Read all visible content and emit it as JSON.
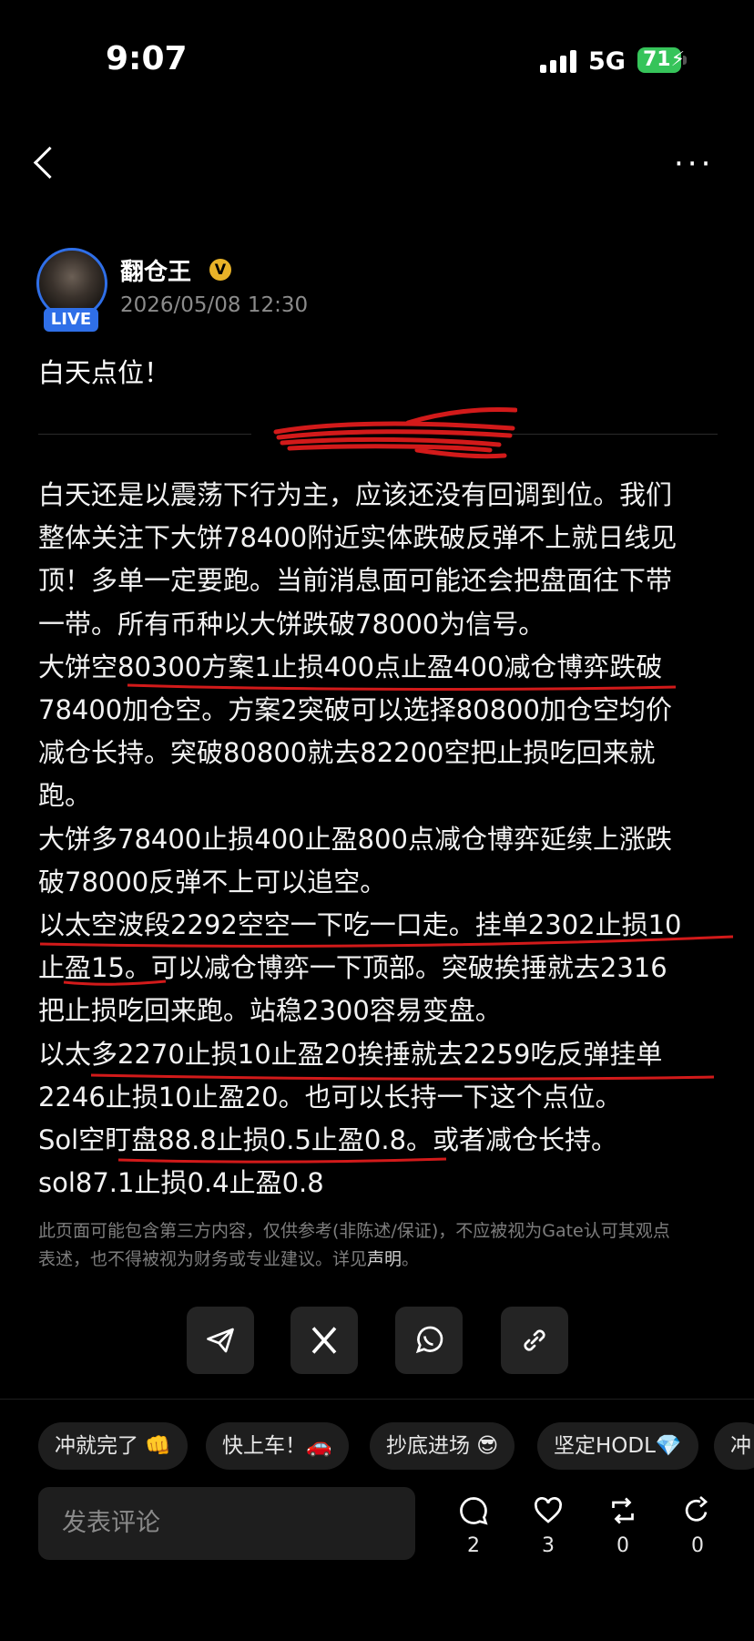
{
  "status_bar": {
    "time": "9:07",
    "network": "5G",
    "battery": "71"
  },
  "post": {
    "author": "翻仓王",
    "live_badge": "LIVE",
    "date": "2026/05/08 12:30",
    "headline": "白天点位！",
    "lines": [
      "白天还是以震荡下行为主，应该还没有回调到位。我们",
      "整体关注下大饼78400附近实体跌破反弹不上就日线见",
      "顶！多单一定要跑。当前消息面可能还会把盘面往下带",
      "一带。所有币种以大饼跌破78000为信号。",
      "大饼空80300方案1止损400点止盈400减仓博弈跌破",
      "78400加仓空。方案2突破可以选择80800加仓空均价",
      "减仓长持。突破80800就去82200空把止损吃回来就",
      "跑。",
      "大饼多78400止损400止盈800点减仓博弈延续上涨跌",
      "破78000反弹不上可以追空。",
      "以太空波段2292空空一下吃一口走。挂单2302止损10",
      "止盈15。可以减仓博弈一下顶部。突破挨捶就去2316",
      "把止损吃回来跑。站稳2300容易变盘。",
      "以太多2270止损10止盈20挨捶就去2259吃反弹挂单",
      "2246止损10止盈20。也可以长持一下这个点位。",
      "Sol空盯盘88.8止损0.5止盈0.8。或者减仓长持。",
      "sol87.1止损0.4止盈0.8"
    ],
    "disclaimer_line1": "此页面可能包含第三方内容，仅供参考(非陈述/保证)，不应被视为Gate认可其观点",
    "disclaimer_line2": "表述，也不得被视为财务或专业建议。详见",
    "disclaimer_link": "声明",
    "disclaimer_end": "。"
  },
  "chips": [
    "冲就完了 👊",
    "快上车！🚗",
    "抄底进场 😎",
    "坚定HODL💎",
    "冲"
  ],
  "comment_placeholder": "发表评论",
  "stats": {
    "comments": "2",
    "likes": "3",
    "reposts": "0",
    "shares": "0"
  },
  "colors": {
    "accent_blue": "#2f6fe8",
    "verified_gold": "#e9b328",
    "annotation_red": "#d21a1a"
  }
}
